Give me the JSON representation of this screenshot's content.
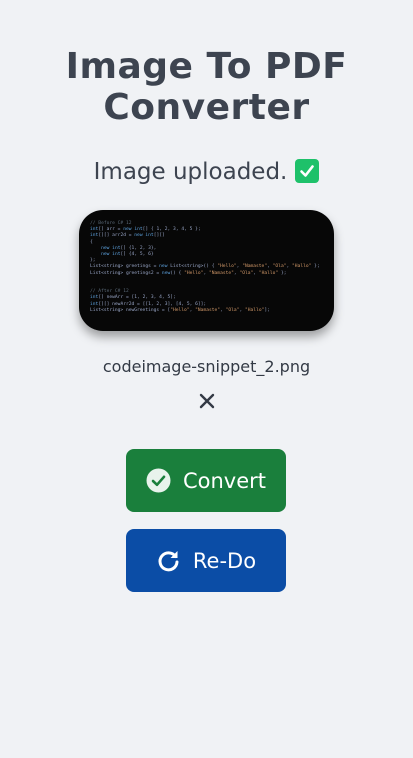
{
  "header": {
    "title_line1": "Image To PDF",
    "title_line2": "Converter"
  },
  "status": {
    "text": "Image uploaded.",
    "icon": "check-box-icon",
    "icon_color": "#1ec16a"
  },
  "preview": {
    "code_lines": [
      "// Before C# 12",
      "int[] arr = new int[] { 1, 2, 3, 4, 5 };",
      "int[][] arr2d = new int[][]",
      "{",
      "    new int[] {1, 2, 3},",
      "    new int[] {4, 5, 6}",
      "};",
      "List<string> greetings = new List<string>() { \"Hello\", \"Namaste\", \"Ola\", \"Hallo\" };",
      "List<string> greetings2 = new() { \"Hello\", \"Namaste\", \"Ola\", \"Hallo\" };",
      "",
      "",
      "// After C# 12",
      "int[] newArr = [1, 2, 3, 4, 5];",
      "int[][] newArr2d = [[1, 2, 3], [4, 5, 6]];",
      "List<string> newGreetings = [\"Hello\", \"Namaste\", \"Ola\", \"Hallo\"];"
    ]
  },
  "file": {
    "name": "codeimage-snippet_2.png",
    "remove_icon": "close-icon"
  },
  "actions": {
    "convert_label": "Convert",
    "convert_icon": "check-circle-icon",
    "convert_color": "#1a7f3c",
    "redo_label": "Re-Do",
    "redo_icon": "redo-icon",
    "redo_color": "#0b4da6"
  }
}
